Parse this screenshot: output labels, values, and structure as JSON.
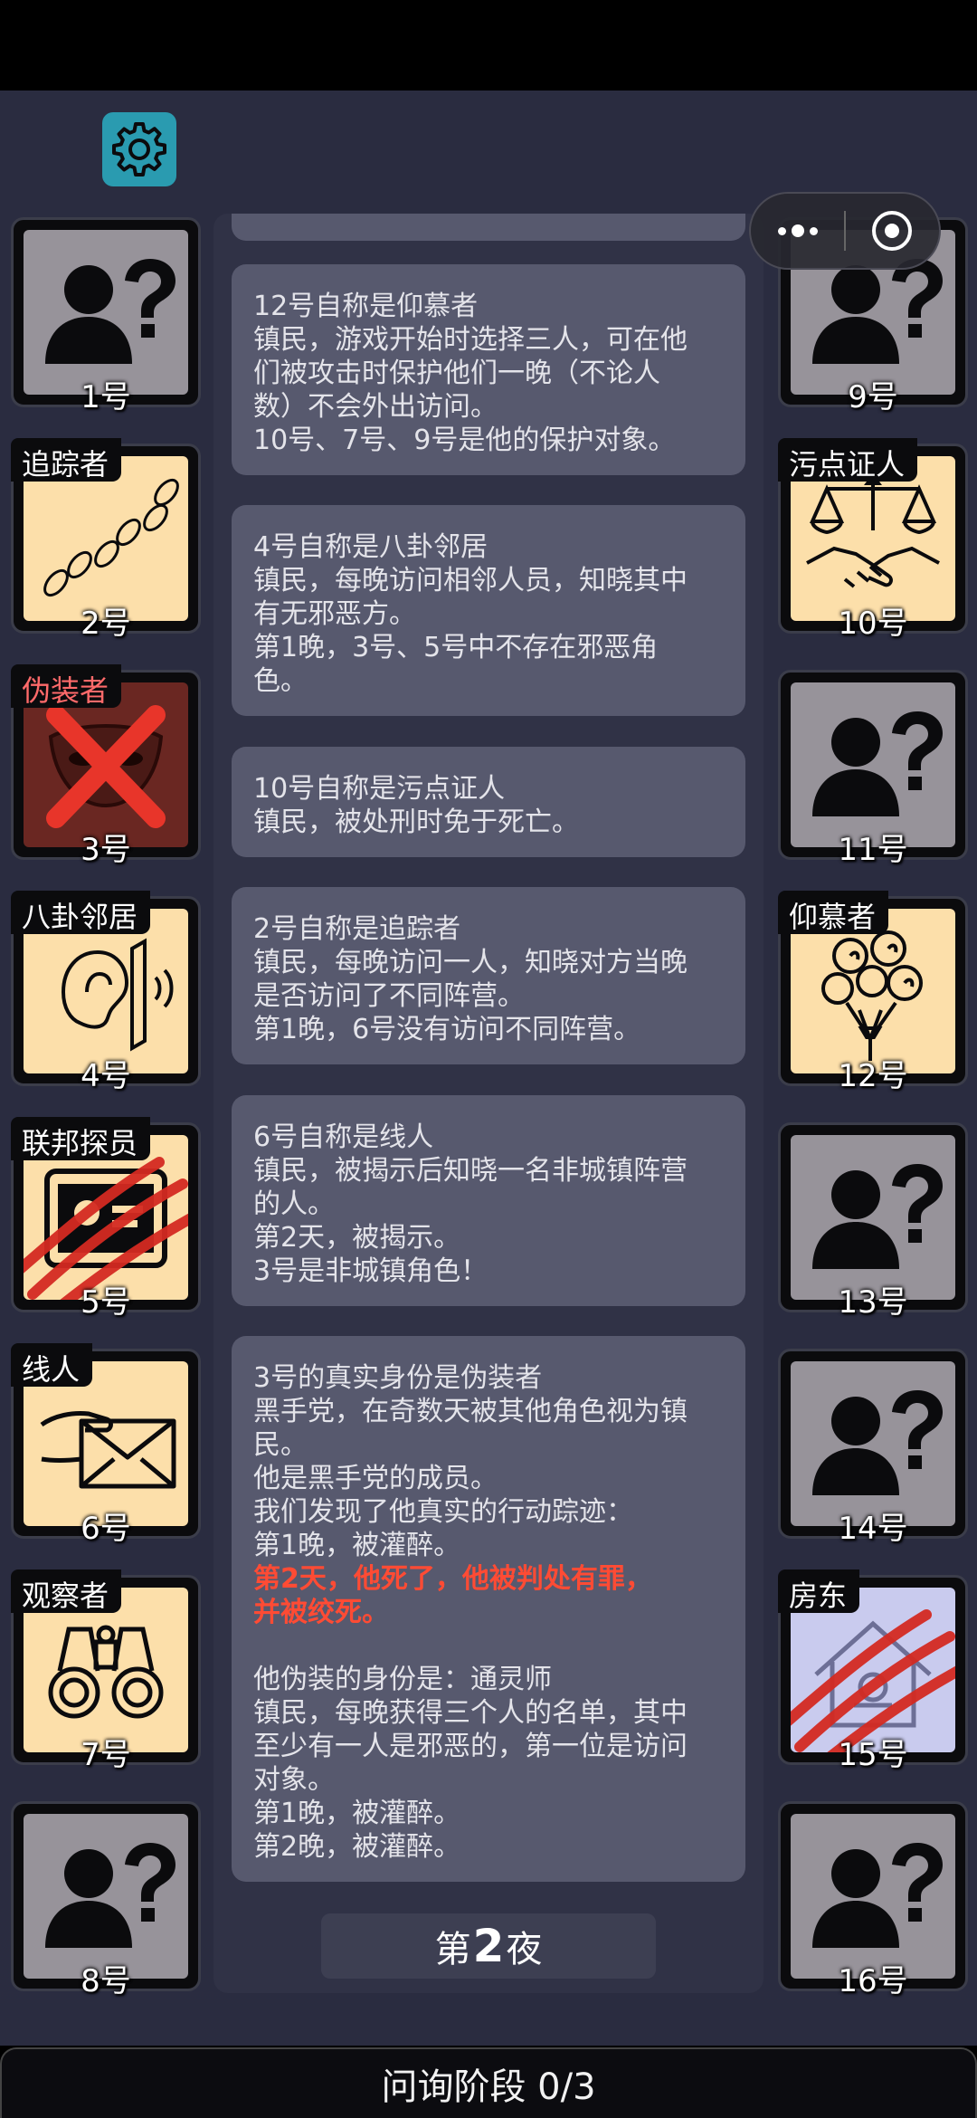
{
  "header": {
    "settings_icon": "gear-icon",
    "capsule_icons": [
      "more-dots-icon",
      "close-target-icon"
    ]
  },
  "left_players": [
    {
      "number": "1号",
      "role": "",
      "icon": "unknown-person-icon",
      "state": "unknown"
    },
    {
      "number": "2号",
      "role": "追踪者",
      "icon": "footprints-icon",
      "state": "revealed"
    },
    {
      "number": "3号",
      "role": "伪装者",
      "icon": "mask-icon",
      "state": "executed"
    },
    {
      "number": "4号",
      "role": "八卦邻居",
      "icon": "ear-wall-icon",
      "state": "revealed"
    },
    {
      "number": "5号",
      "role": "联邦探员",
      "icon": "badge-icon",
      "state": "attacked"
    },
    {
      "number": "6号",
      "role": "线人",
      "icon": "hand-envelope-icon",
      "state": "revealed"
    },
    {
      "number": "7号",
      "role": "观察者",
      "icon": "binoculars-icon",
      "state": "revealed"
    },
    {
      "number": "8号",
      "role": "",
      "icon": "unknown-person-icon",
      "state": "unknown"
    }
  ],
  "right_players": [
    {
      "number": "9号",
      "role": "",
      "icon": "unknown-person-icon",
      "state": "unknown"
    },
    {
      "number": "10号",
      "role": "污点证人",
      "icon": "scales-handshake-icon",
      "state": "revealed"
    },
    {
      "number": "11号",
      "role": "",
      "icon": "unknown-person-icon",
      "state": "unknown"
    },
    {
      "number": "12号",
      "role": "仰慕者",
      "icon": "flowers-icon",
      "state": "revealed"
    },
    {
      "number": "13号",
      "role": "",
      "icon": "unknown-person-icon",
      "state": "unknown"
    },
    {
      "number": "14号",
      "role": "",
      "icon": "unknown-person-icon",
      "state": "unknown"
    },
    {
      "number": "15号",
      "role": "房东",
      "icon": "house-icon",
      "state": "attacked"
    },
    {
      "number": "16号",
      "role": "",
      "icon": "unknown-person-icon",
      "state": "unknown"
    }
  ],
  "messages": [
    {
      "lines": [
        "12号自称是仰慕者",
        "镇民，游戏开始时选择三人，可在他",
        "们被攻击时保护他们一晚（不论人",
        "数）不会外出访问。",
        "10号、7号、9号是他的保护对象。"
      ]
    },
    {
      "lines": [
        "4号自称是八卦邻居",
        "镇民，每晚访问相邻人员，知晓其中",
        "有无邪恶方。",
        "第1晚，3号、5号中不存在邪恶角",
        "色。"
      ]
    },
    {
      "lines": [
        "10号自称是污点证人",
        "镇民，被处刑时免于死亡。"
      ]
    },
    {
      "lines": [
        "2号自称是追踪者",
        "镇民，每晚访问一人，知晓对方当晚",
        "是否访问了不同阵营。",
        "第1晚，6号没有访问不同阵营。"
      ]
    },
    {
      "lines": [
        "6号自称是线人",
        "镇民，被揭示后知晓一名非城镇阵营",
        "的人。",
        "第2天，被揭示。",
        "3号是非城镇角色！"
      ]
    },
    {
      "lines_a": [
        "3号的真实身份是伪装者",
        "黑手党，在奇数天被其他角色视为镇",
        "民。",
        "他是黑手党的成员。",
        "我们发现了他真实的行动踪迹：",
        "第1晚，被灌醉。"
      ],
      "red_lines": [
        "第2天，他死了，他被判处有罪，",
        "并被绞死。"
      ],
      "lines_b": [
        "他伪装的身份是：通灵师",
        "镇民，每晚获得三个人的名单，其中",
        "至少有一人是邪恶的，第一位是访问",
        "对象。",
        "第1晚，被灌醉。",
        "第2晚，被灌醉。"
      ]
    }
  ],
  "night": {
    "prefix": "第",
    "number": "2",
    "suffix": "夜"
  },
  "phase": {
    "label": "问询阶段 0/3"
  },
  "colors": {
    "background": "#2a2c40",
    "panel": "#303246",
    "message": "#57596e",
    "accent": "#2a9bb0",
    "alert": "#ff4b34",
    "role_card": "#fcdfaa"
  }
}
